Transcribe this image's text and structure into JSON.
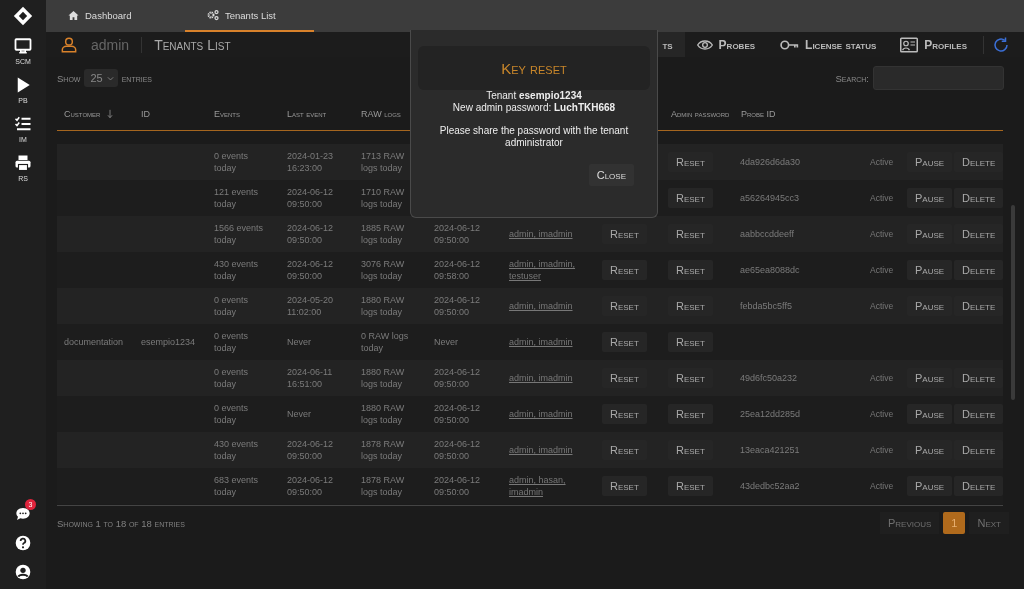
{
  "sidebar": {
    "items": [
      {
        "label": "SCM"
      },
      {
        "label": "PB"
      },
      {
        "label": "IM"
      },
      {
        "label": "RS"
      }
    ],
    "chat_badge": "3"
  },
  "top_tabs": [
    {
      "label": "Dashboard",
      "selected": false
    },
    {
      "label": "Tenants List",
      "selected": true
    }
  ],
  "header": {
    "user": "admin",
    "title": "Tenants List",
    "nav": [
      {
        "label": "ts",
        "selected": true
      },
      {
        "label": "Probes",
        "selected": false
      },
      {
        "label": "License status",
        "selected": false
      },
      {
        "label": "Profiles",
        "selected": false
      }
    ]
  },
  "controls": {
    "show": "Show",
    "page_size": "25",
    "entries": "entries",
    "search_label": "Search:"
  },
  "table": {
    "columns": [
      {
        "label": "Customer",
        "sorted": true
      },
      {
        "label": "ID"
      },
      {
        "label": "Events"
      },
      {
        "label": "Last event"
      },
      {
        "label": "RAW logs"
      },
      {
        "label": "Admin password"
      },
      {
        "label": "Probe ID"
      }
    ],
    "rows": [
      {
        "events": "0 events today",
        "last_event": "2024-01-23 16:23:00",
        "raw_logs": "1713 RAW logs today",
        "admin_reset": "Reset",
        "probe_id": "4da926d6da30",
        "status": "Active",
        "pause": "Pause",
        "delete": "Delete"
      },
      {
        "events": "121 events today",
        "last_event": "2024-06-12 09:50:00",
        "raw_logs": "1710 RAW logs today",
        "admin_reset": "Reset",
        "probe_id": "a56264945cc3",
        "status": "Active",
        "pause": "Pause",
        "delete": "Delete"
      },
      {
        "events": "1566 events today",
        "last_event": "2024-06-12 09:50:00",
        "raw_logs": "1885 RAW logs today",
        "last_raw": "2024-06-12 09:50:00",
        "users": "admin, imadmin",
        "password_reset": "Reset",
        "admin_reset": "Reset",
        "probe_id": "aabbccddeeff",
        "status": "Active",
        "pause": "Pause",
        "delete": "Delete"
      },
      {
        "events": "430 events today",
        "last_event": "2024-06-12 09:50:00",
        "raw_logs": "3076 RAW logs today",
        "last_raw": "2024-06-12 09:58:00",
        "users": "admin, imadmin, testuser",
        "password_reset": "Reset",
        "admin_reset": "Reset",
        "probe_id": "ae65ea8088dc",
        "status": "Active",
        "pause": "Pause",
        "delete": "Delete"
      },
      {
        "events": "0 events today",
        "last_event": "2024-05-20 11:02:00",
        "raw_logs": "1880 RAW logs today",
        "last_raw": "2024-06-12 09:50:00",
        "users": "admin, imadmin",
        "password_reset": "Reset",
        "admin_reset": "Reset",
        "probe_id": "febda5bc5ff5",
        "status": "Active",
        "pause": "Pause",
        "delete": "Delete"
      },
      {
        "customer": "documentation",
        "id": "esempio1234",
        "events": "0 events today",
        "last_event": "Never",
        "raw_logs": "0 RAW logs today",
        "last_raw": "Never",
        "users": "admin, imadmin",
        "password_reset": "Reset",
        "admin_reset": "Reset"
      },
      {
        "events": "0 events today",
        "last_event": "2024-06-11 16:51:00",
        "raw_logs": "1880 RAW logs today",
        "last_raw": "2024-06-12 09:50:00",
        "users": "admin, imadmin",
        "password_reset": "Reset",
        "admin_reset": "Reset",
        "probe_id": "49d6fc50a232",
        "status": "Active",
        "pause": "Pause",
        "delete": "Delete"
      },
      {
        "events": "0 events today",
        "last_event": "Never",
        "raw_logs": "1880 RAW logs today",
        "last_raw": "2024-06-12 09:50:00",
        "users": "admin, imadmin",
        "password_reset": "Reset",
        "admin_reset": "Reset",
        "probe_id": "25ea12dd285d",
        "status": "Active",
        "pause": "Pause",
        "delete": "Delete"
      },
      {
        "events": "430 events today",
        "last_event": "2024-06-12 09:50:00",
        "raw_logs": "1878 RAW logs today",
        "last_raw": "2024-06-12 09:50:00",
        "users": "admin, imadmin",
        "password_reset": "Reset",
        "admin_reset": "Reset",
        "probe_id": "13eaca421251",
        "status": "Active",
        "pause": "Pause",
        "delete": "Delete"
      },
      {
        "events": "683 events today",
        "last_event": "2024-06-12 09:50:00",
        "raw_logs": "1878 RAW logs today",
        "last_raw": "2024-06-12 09:50:00",
        "users": "admin, hasan, imadmin",
        "password_reset": "Reset",
        "admin_reset": "Reset",
        "probe_id": "43dedbc52aa2",
        "status": "Active",
        "pause": "Pause",
        "delete": "Delete"
      }
    ]
  },
  "footer": {
    "info": "Showing 1 to 18 of 18 entries",
    "pages": [
      {
        "label": "Previous",
        "selected": false
      },
      {
        "label": "1",
        "selected": true
      },
      {
        "label": "Next",
        "selected": false
      }
    ]
  },
  "modal": {
    "title": "Key reset",
    "lines": [
      "Tenant **esempio1234**",
      "New admin password: **LuchTKH668**"
    ],
    "note": "Please share the password with the tenant administrator",
    "close": "Close"
  }
}
